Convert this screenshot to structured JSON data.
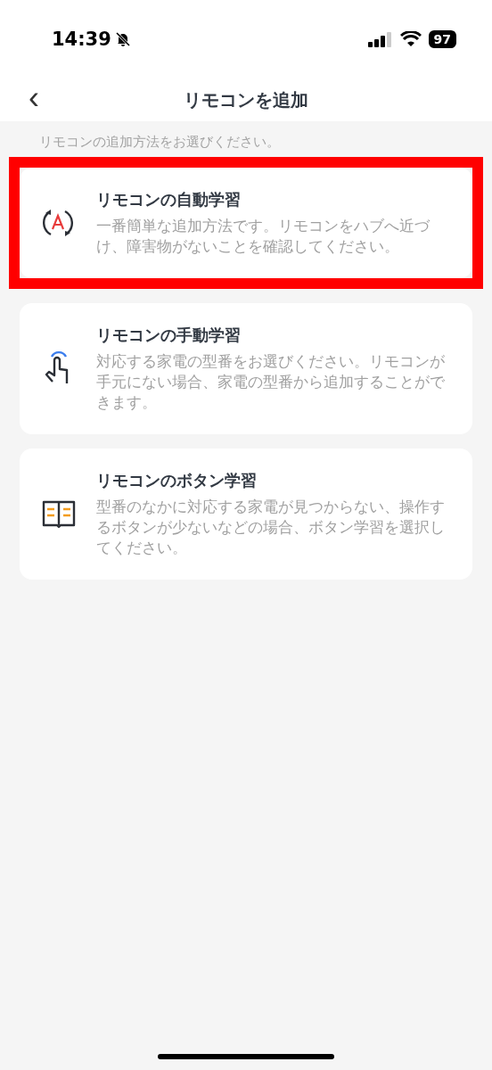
{
  "status_bar": {
    "time": "14:39",
    "battery": "97"
  },
  "nav": {
    "back": "‹",
    "title": "リモコンを追加"
  },
  "subtitle": "リモコンの追加方法をお選びください。",
  "options": [
    {
      "kind": "auto",
      "title": "リモコンの自動学習",
      "description": "一番簡単な追加方法です。リモコンをハブへ近づけ、障害物がないことを確認してください。",
      "highlighted": true
    },
    {
      "kind": "manual",
      "title": "リモコンの手動学習",
      "description": "対応する家電の型番をお選びください。リモコンが手元にない場合、家電の型番から追加することができます。",
      "highlighted": false
    },
    {
      "kind": "button",
      "title": "リモコンのボタン学習",
      "description": "型番のなかに対応する家電が見つからない、操作するボタンが少ないなどの場合、ボタン学習を選択してください。",
      "highlighted": false
    }
  ]
}
